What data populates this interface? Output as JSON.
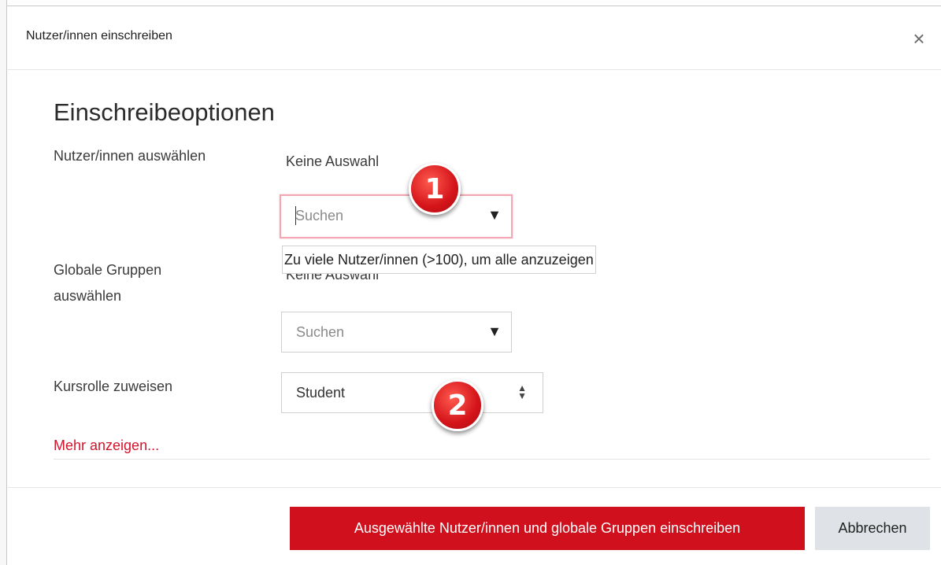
{
  "modal": {
    "title": "Nutzer/innen einschreiben",
    "close_icon": "×"
  },
  "section": {
    "title": "Einschreibeoptionen"
  },
  "users": {
    "label": "Nutzer/innen auswählen",
    "selection": "Keine Auswahl",
    "search_placeholder": "Suchen",
    "tooltip": "Zu viele Nutzer/innen (>100), um alle anzuzeigen",
    "arrow_icon": "▼"
  },
  "groups": {
    "label_line1": "Globale Gruppen",
    "label_line2": "auswählen",
    "selection": "Keine Auswahl",
    "search_placeholder": "Suchen",
    "arrow_icon": "▼"
  },
  "role": {
    "label": "Kursrolle zuweisen",
    "value": "Student",
    "updown_icon": "⬍"
  },
  "more_link": "Mehr anzeigen...",
  "badges": {
    "one": "1",
    "two": "2"
  },
  "buttons": {
    "enrol": "Ausgewählte Nutzer/innen und globale Gruppen einschreiben",
    "cancel": "Abbrechen"
  },
  "colors": {
    "primary": "#d0101c",
    "secondary": "#dfe2e6",
    "link": "#d0142c",
    "badge": "#d4141a"
  }
}
